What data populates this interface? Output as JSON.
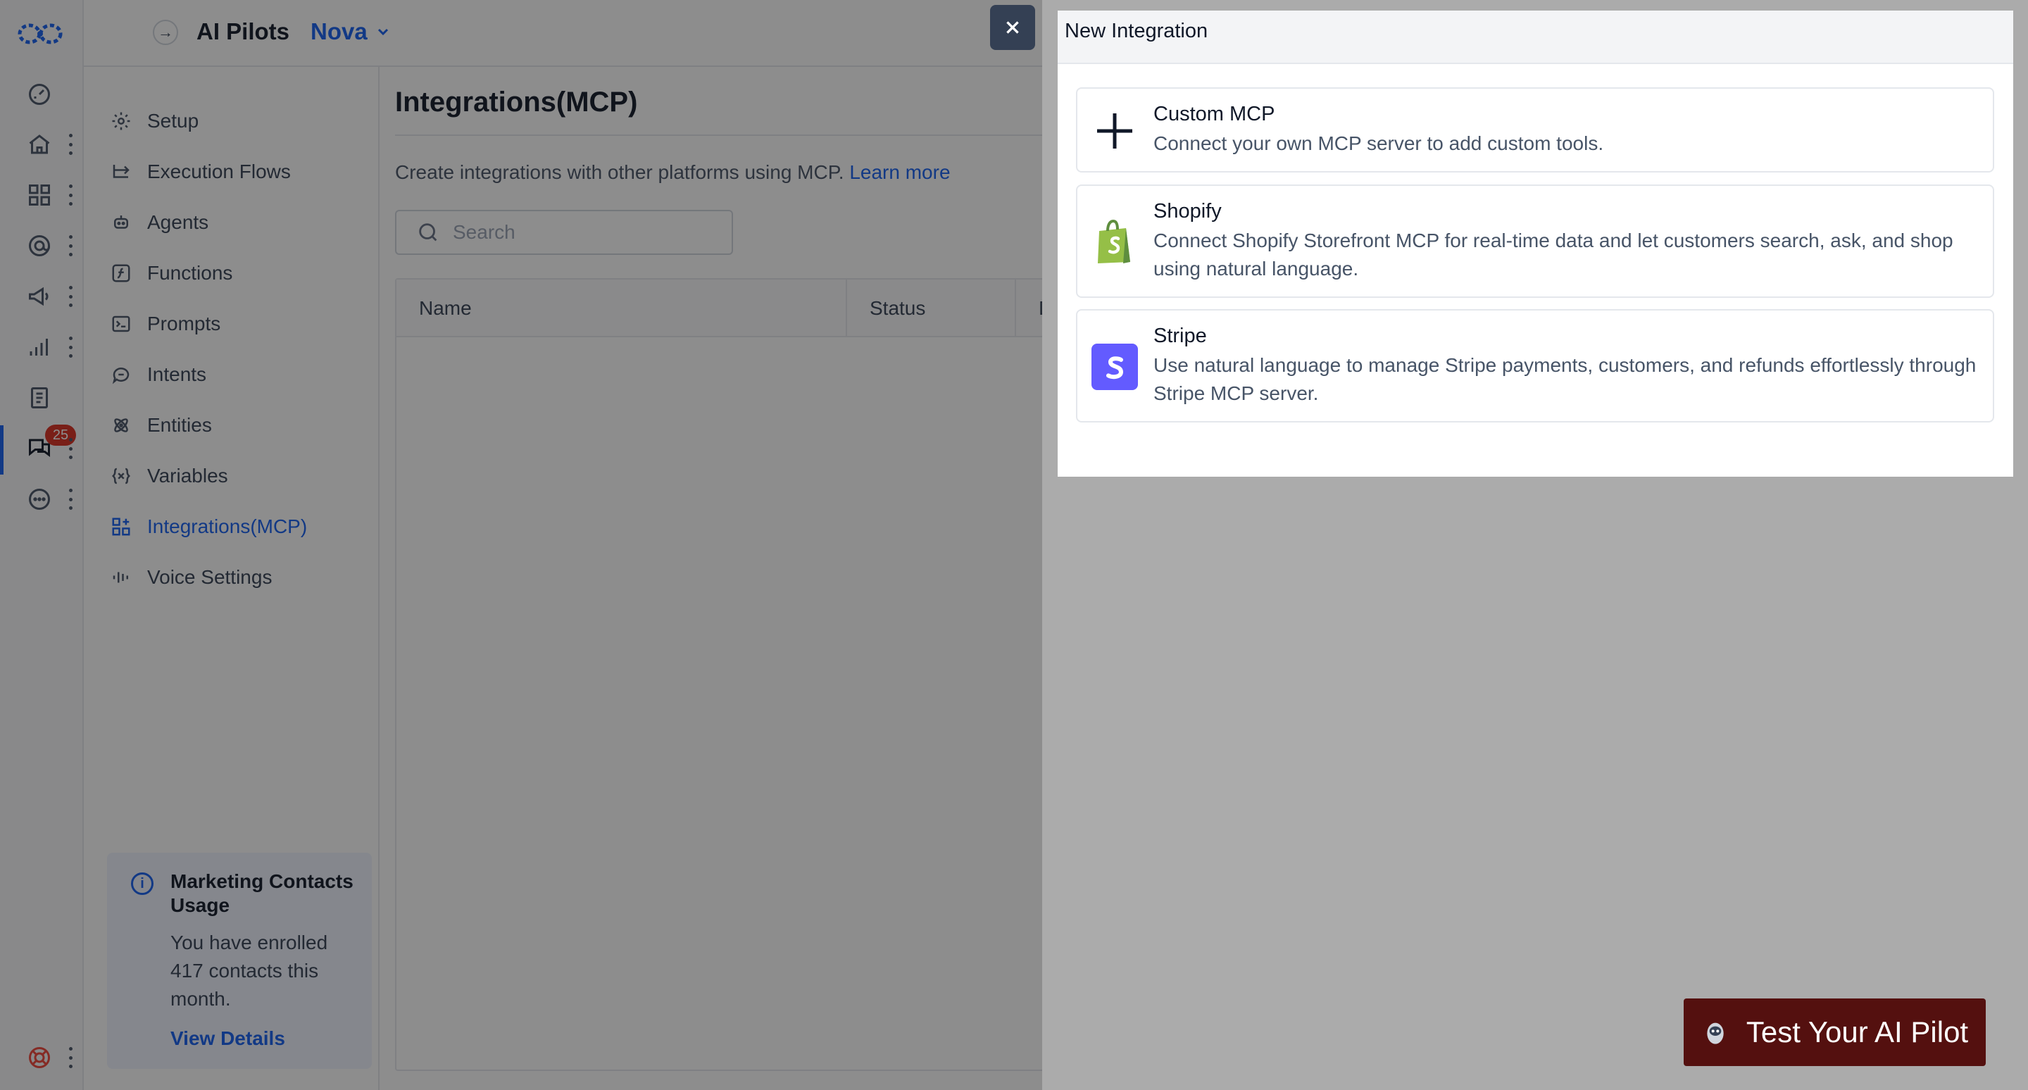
{
  "topbar": {
    "app_title": "AI Pilots",
    "bot_name": "Nova"
  },
  "leftnav": {
    "badge_count": "25",
    "icons": [
      "dashboard-icon",
      "home-icon",
      "apps-icon",
      "contacts-icon",
      "megaphone-icon",
      "reports-icon",
      "document-icon",
      "conversations-icon",
      "more-icon",
      "support-icon"
    ]
  },
  "subnav": {
    "items": [
      {
        "label": "Setup",
        "icon": "gear-icon"
      },
      {
        "label": "Execution Flows",
        "icon": "flow-icon"
      },
      {
        "label": "Agents",
        "icon": "agent-icon"
      },
      {
        "label": "Functions",
        "icon": "function-icon"
      },
      {
        "label": "Prompts",
        "icon": "prompt-icon"
      },
      {
        "label": "Intents",
        "icon": "chat-bubble-icon"
      },
      {
        "label": "Entities",
        "icon": "atom-icon"
      },
      {
        "label": "Variables",
        "icon": "variable-icon"
      },
      {
        "label": "Integrations(MCP)",
        "icon": "grid-plus-icon",
        "active": true
      },
      {
        "label": "Voice Settings",
        "icon": "waveform-icon"
      }
    ]
  },
  "usage": {
    "title": "Marketing Contacts Usage",
    "text": "You have enrolled 417 contacts this month.",
    "link": "View Details"
  },
  "main": {
    "title": "Integrations(MCP)",
    "description": "Create integrations with other platforms using MCP.",
    "learn_more": "Learn more",
    "search_placeholder": "Search",
    "columns": [
      "Name",
      "Status",
      "D"
    ]
  },
  "modal": {
    "title": "New Integration",
    "integrations": [
      {
        "name": "Custom MCP",
        "description": "Connect your own MCP server to add custom tools.",
        "icon": "plus-icon"
      },
      {
        "name": "Shopify",
        "description": "Connect Shopify Storefront MCP for real-time data and let customers search, ask, and shop using natural language.",
        "icon": "shopify-bag-icon"
      },
      {
        "name": "Stripe",
        "description": "Use natural language to manage Stripe payments, customers, and refunds effortlessly through Stripe MCP server.",
        "icon": "stripe-s-icon"
      }
    ]
  },
  "test_button": {
    "label": "Test Your AI Pilot"
  },
  "colors": {
    "accent": "#155eef",
    "badge": "#d92d20",
    "stripe": "#635bff",
    "shopify": "#95bf47",
    "test_button": "#54100f"
  }
}
